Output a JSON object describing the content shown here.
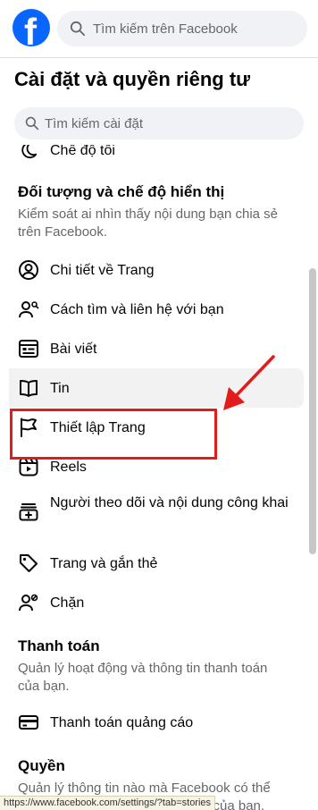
{
  "header": {
    "logo_letter": "f",
    "search_placeholder": "Tìm kiếm trên Facebook"
  },
  "panel": {
    "title": "Cài đặt và quyền riêng tư",
    "search_placeholder": "Tìm kiếm cài đặt"
  },
  "partial_item": {
    "label": "Chế độ tối"
  },
  "audience_section": {
    "title": "Đối tượng và chế độ hiển thị",
    "description": "Kiểm soát ai nhìn thấy nội dung bạn chia sẻ trên Facebook.",
    "items": [
      {
        "label": "Chi tiết về Trang",
        "icon": "person-circle-icon"
      },
      {
        "label": "Cách tìm và liên hệ với bạn",
        "icon": "person-search-icon"
      },
      {
        "label": "Bài viết",
        "icon": "post-icon"
      },
      {
        "label": "Tin",
        "icon": "book-icon"
      },
      {
        "label": "Thiết lập Trang",
        "icon": "flag-icon"
      },
      {
        "label": "Reels",
        "icon": "reels-icon"
      },
      {
        "label": "Người theo dõi và nội dung công khai",
        "icon": "followers-icon"
      },
      {
        "label": "Trang và gắn thẻ",
        "icon": "tag-icon"
      },
      {
        "label": "Chặn",
        "icon": "block-icon"
      }
    ]
  },
  "payment_section": {
    "title": "Thanh toán",
    "description": "Quản lý hoạt động và thông tin thanh toán của bạn.",
    "items": [
      {
        "label": "Thanh toán quảng cáo",
        "icon": "card-icon"
      }
    ]
  },
  "permissions_section": {
    "title": "Quyền",
    "description": "Quản lý thông tin nào mà Facebook có thể sử dụng để cải thiện trải nghiệm của bạn."
  },
  "status_bar": {
    "url": "https://www.facebook.com/settings/?tab=stories"
  },
  "colors": {
    "brand": "#0866ff",
    "annotation": "#e21b1b"
  }
}
